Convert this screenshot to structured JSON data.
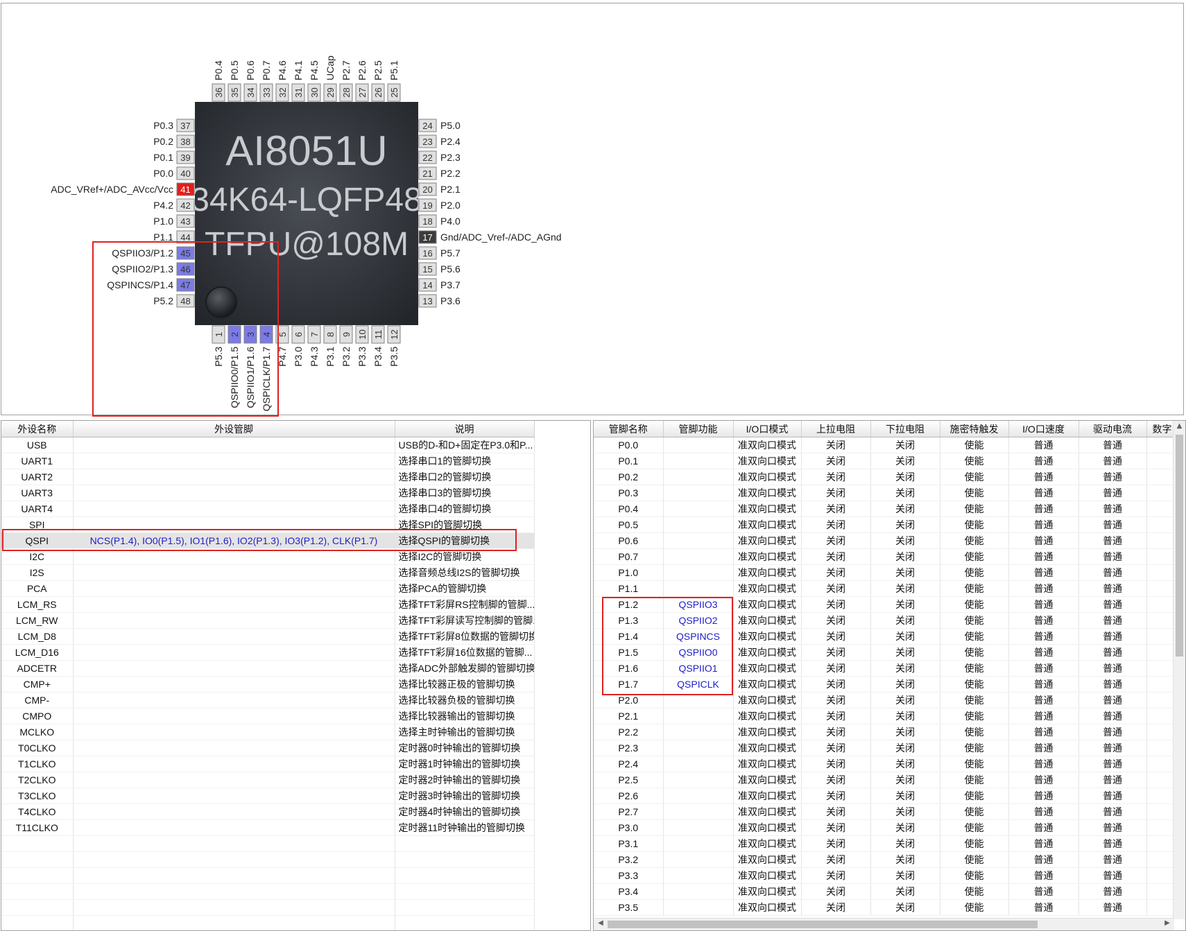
{
  "chip": {
    "name": "AI8051U",
    "line2": "34K64-LQFP48",
    "line3": "TFPU@108M"
  },
  "colors": {
    "pin_normal": "#e0e0e0",
    "pin_qspi": "#7b7be6",
    "pin_power": "#e31e1e",
    "pin_gnd": "#3c3c3c",
    "highlight": "#e02020",
    "function_text": "#1d1dc8"
  },
  "pins": {
    "top": [
      {
        "num": "36",
        "label": "P0.4"
      },
      {
        "num": "35",
        "label": "P0.5"
      },
      {
        "num": "34",
        "label": "P0.6"
      },
      {
        "num": "33",
        "label": "P0.7"
      },
      {
        "num": "32",
        "label": "P4.6"
      },
      {
        "num": "31",
        "label": "P4.1"
      },
      {
        "num": "30",
        "label": "P4.5"
      },
      {
        "num": "29",
        "label": "UCap"
      },
      {
        "num": "28",
        "label": "P2.7"
      },
      {
        "num": "27",
        "label": "P2.6"
      },
      {
        "num": "26",
        "label": "P2.5"
      },
      {
        "num": "25",
        "label": "P5.1"
      }
    ],
    "left": [
      {
        "num": "37",
        "label": "P0.3",
        "kind": "normal"
      },
      {
        "num": "38",
        "label": "P0.2",
        "kind": "normal"
      },
      {
        "num": "39",
        "label": "P0.1",
        "kind": "normal"
      },
      {
        "num": "40",
        "label": "P0.0",
        "kind": "normal"
      },
      {
        "num": "41",
        "label": "ADC_VRef+/ADC_AVcc/Vcc",
        "kind": "power"
      },
      {
        "num": "42",
        "label": "P4.2",
        "kind": "normal"
      },
      {
        "num": "43",
        "label": "P1.0",
        "kind": "normal"
      },
      {
        "num": "44",
        "label": "P1.1",
        "kind": "normal"
      },
      {
        "num": "45",
        "label": "QSPIIO3/P1.2",
        "kind": "qspi"
      },
      {
        "num": "46",
        "label": "QSPIIO2/P1.3",
        "kind": "qspi"
      },
      {
        "num": "47",
        "label": "QSPINCS/P1.4",
        "kind": "qspi"
      },
      {
        "num": "48",
        "label": "P5.2",
        "kind": "normal"
      }
    ],
    "right": [
      {
        "num": "24",
        "label": "P5.0",
        "kind": "normal"
      },
      {
        "num": "23",
        "label": "P2.4",
        "kind": "normal"
      },
      {
        "num": "22",
        "label": "P2.3",
        "kind": "normal"
      },
      {
        "num": "21",
        "label": "P2.2",
        "kind": "normal"
      },
      {
        "num": "20",
        "label": "P2.1",
        "kind": "normal"
      },
      {
        "num": "19",
        "label": "P2.0",
        "kind": "normal"
      },
      {
        "num": "18",
        "label": "P4.0",
        "kind": "normal"
      },
      {
        "num": "17",
        "label": "Gnd/ADC_Vref-/ADC_AGnd",
        "kind": "gnd"
      },
      {
        "num": "16",
        "label": "P5.7",
        "kind": "normal"
      },
      {
        "num": "15",
        "label": "P5.6",
        "kind": "normal"
      },
      {
        "num": "14",
        "label": "P3.7",
        "kind": "normal"
      },
      {
        "num": "13",
        "label": "P3.6",
        "kind": "normal"
      }
    ],
    "bottom": [
      {
        "num": "1",
        "label": "P5.3",
        "kind": "normal"
      },
      {
        "num": "2",
        "label": "QSPIIO0/P1.5",
        "kind": "qspi"
      },
      {
        "num": "3",
        "label": "QSPIIO1/P1.6",
        "kind": "qspi"
      },
      {
        "num": "4",
        "label": "QSPICLK/P1.7",
        "kind": "qspi"
      },
      {
        "num": "5",
        "label": "P4.7",
        "kind": "normal"
      },
      {
        "num": "6",
        "label": "P3.0",
        "kind": "normal"
      },
      {
        "num": "7",
        "label": "P4.3",
        "kind": "normal"
      },
      {
        "num": "8",
        "label": "P3.1",
        "kind": "normal"
      },
      {
        "num": "9",
        "label": "P3.2",
        "kind": "normal"
      },
      {
        "num": "10",
        "label": "P3.3",
        "kind": "normal"
      },
      {
        "num": "11",
        "label": "P3.4",
        "kind": "normal"
      },
      {
        "num": "12",
        "label": "P3.5",
        "kind": "normal"
      }
    ]
  },
  "peripheral_table": {
    "headers": [
      "外设名称",
      "外设管脚",
      "说明"
    ],
    "rows": [
      {
        "name": "USB",
        "pins": "",
        "desc": "USB的D-和D+固定在P3.0和P..."
      },
      {
        "name": "UART1",
        "pins": "",
        "desc": "选择串口1的管脚切换"
      },
      {
        "name": "UART2",
        "pins": "",
        "desc": "选择串口2的管脚切换"
      },
      {
        "name": "UART3",
        "pins": "",
        "desc": "选择串口3的管脚切换"
      },
      {
        "name": "UART4",
        "pins": "",
        "desc": "选择串口4的管脚切换"
      },
      {
        "name": "SPI",
        "pins": "",
        "desc": "选择SPI的管脚切换"
      },
      {
        "name": "QSPI",
        "pins": "NCS(P1.4), IO0(P1.5), IO1(P1.6), IO2(P1.3), IO3(P1.2), CLK(P1.7)",
        "desc": "选择QSPI的管脚切换",
        "selected": true
      },
      {
        "name": "I2C",
        "pins": "",
        "desc": "选择I2C的管脚切换"
      },
      {
        "name": "I2S",
        "pins": "",
        "desc": "选择音频总线I2S的管脚切换"
      },
      {
        "name": "PCA",
        "pins": "",
        "desc": "选择PCA的管脚切换"
      },
      {
        "name": "LCM_RS",
        "pins": "",
        "desc": "选择TFT彩屏RS控制脚的管脚..."
      },
      {
        "name": "LCM_RW",
        "pins": "",
        "desc": "选择TFT彩屏读写控制脚的管脚..."
      },
      {
        "name": "LCM_D8",
        "pins": "",
        "desc": "选择TFT彩屏8位数据的管脚切换"
      },
      {
        "name": "LCM_D16",
        "pins": "",
        "desc": "选择TFT彩屏16位数据的管脚..."
      },
      {
        "name": "ADCETR",
        "pins": "",
        "desc": "选择ADC外部触发脚的管脚切换"
      },
      {
        "name": "CMP+",
        "pins": "",
        "desc": "选择比较器正极的管脚切换"
      },
      {
        "name": "CMP-",
        "pins": "",
        "desc": "选择比较器负极的管脚切换"
      },
      {
        "name": "CMPO",
        "pins": "",
        "desc": "选择比较器输出的管脚切换"
      },
      {
        "name": "MCLKO",
        "pins": "",
        "desc": "选择主时钟输出的管脚切换"
      },
      {
        "name": "T0CLKO",
        "pins": "",
        "desc": "定时器0时钟输出的管脚切换"
      },
      {
        "name": "T1CLKO",
        "pins": "",
        "desc": "定时器1时钟输出的管脚切换"
      },
      {
        "name": "T2CLKO",
        "pins": "",
        "desc": "定时器2时钟输出的管脚切换"
      },
      {
        "name": "T3CLKO",
        "pins": "",
        "desc": "定时器3时钟输出的管脚切换"
      },
      {
        "name": "T4CLKO",
        "pins": "",
        "desc": "定时器4时钟输出的管脚切换"
      },
      {
        "name": "T11CLKO",
        "pins": "",
        "desc": "定时器11时钟输出的管脚切换"
      }
    ],
    "empty_rows": 6
  },
  "pin_table": {
    "headers": [
      "管脚名称",
      "管脚功能",
      "I/O口模式",
      "上拉电阻",
      "下拉电阻",
      "施密特触发",
      "I/O口速度",
      "驱动电流",
      "数字"
    ],
    "defaults": {
      "mode": "准双向口模式",
      "pullup": "关闭",
      "pulldown": "关闭",
      "schmitt": "使能",
      "speed": "普通",
      "drive": "普通"
    },
    "rows": [
      {
        "pin": "P0.0",
        "func": ""
      },
      {
        "pin": "P0.1",
        "func": ""
      },
      {
        "pin": "P0.2",
        "func": ""
      },
      {
        "pin": "P0.3",
        "func": ""
      },
      {
        "pin": "P0.4",
        "func": ""
      },
      {
        "pin": "P0.5",
        "func": ""
      },
      {
        "pin": "P0.6",
        "func": ""
      },
      {
        "pin": "P0.7",
        "func": ""
      },
      {
        "pin": "P1.0",
        "func": ""
      },
      {
        "pin": "P1.1",
        "func": ""
      },
      {
        "pin": "P1.2",
        "func": "QSPIIO3"
      },
      {
        "pin": "P1.3",
        "func": "QSPIIO2"
      },
      {
        "pin": "P1.4",
        "func": "QSPINCS"
      },
      {
        "pin": "P1.5",
        "func": "QSPIIO0"
      },
      {
        "pin": "P1.6",
        "func": "QSPIIO1"
      },
      {
        "pin": "P1.7",
        "func": "QSPICLK"
      },
      {
        "pin": "P2.0",
        "func": ""
      },
      {
        "pin": "P2.1",
        "func": ""
      },
      {
        "pin": "P2.2",
        "func": ""
      },
      {
        "pin": "P2.3",
        "func": ""
      },
      {
        "pin": "P2.4",
        "func": ""
      },
      {
        "pin": "P2.5",
        "func": ""
      },
      {
        "pin": "P2.6",
        "func": ""
      },
      {
        "pin": "P2.7",
        "func": ""
      },
      {
        "pin": "P3.0",
        "func": ""
      },
      {
        "pin": "P3.1",
        "func": ""
      },
      {
        "pin": "P3.2",
        "func": ""
      },
      {
        "pin": "P3.3",
        "func": ""
      },
      {
        "pin": "P3.4",
        "func": ""
      },
      {
        "pin": "P3.5",
        "func": ""
      }
    ]
  }
}
